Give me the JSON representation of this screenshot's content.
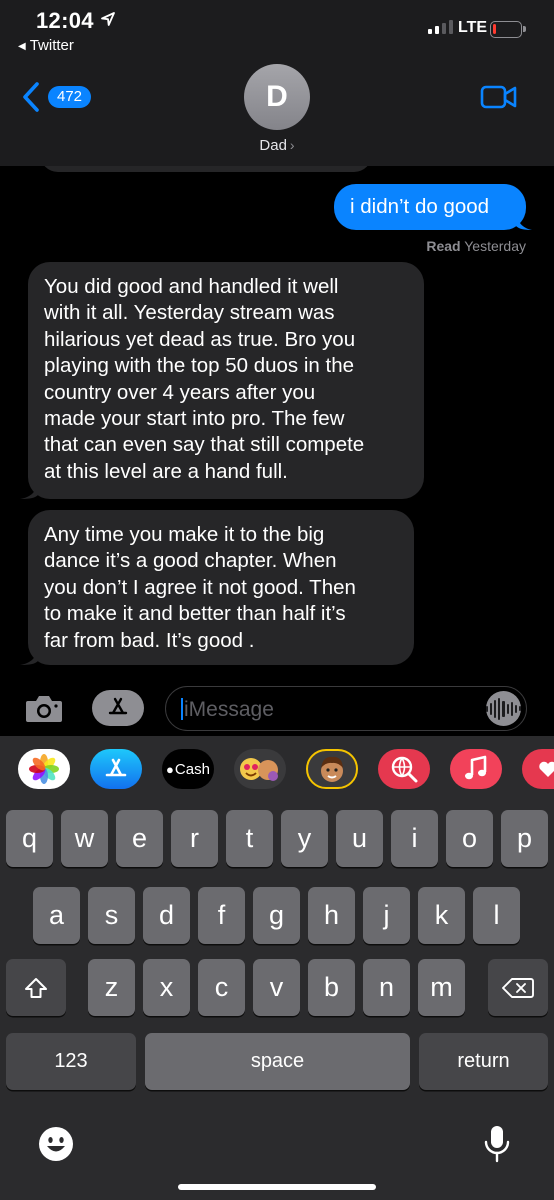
{
  "status_bar": {
    "time": "12:04",
    "back_app": "Twitter",
    "network": "LTE",
    "battery_level": 0.1,
    "battery_color": "#ff3b30"
  },
  "nav": {
    "back_count": "472",
    "avatar_initial": "D",
    "contact_name": "Dad",
    "video_icon": "video-camera-icon",
    "accent": "#0a84ff"
  },
  "messages": {
    "outgoing": [
      {
        "text": "i didn’t do good",
        "status_label": "Read",
        "status_time": "Yesterday"
      }
    ],
    "incoming": [
      {
        "lines": [
          "You did good and handled it well",
          "with it all. Yesterday stream was",
          "hilarious yet dead as true. Bro you",
          "playing with the top 50 duos in the",
          "country over 4 years after you",
          "made your start into pro. The few",
          "that can even say that still compete",
          "at this level are a hand full."
        ]
      },
      {
        "lines": [
          "Any time you make it to the big",
          "dance it’s a good chapter. When",
          "you don’t I agree it not good. Then",
          "to make it and better than half it’s",
          "far from bad. It’s good ."
        ]
      }
    ]
  },
  "composer": {
    "placeholder": "iMessage",
    "camera_icon": "camera-icon",
    "apps_icon": "app-store-icon",
    "audio_icon": "waveform-icon"
  },
  "app_strip": {
    "apps": [
      "photos",
      "app-store",
      "apple-cash",
      "memoji-stickers",
      "memoji",
      "web-images",
      "music",
      "more"
    ],
    "cash_label": "Cash"
  },
  "keyboard": {
    "row1": [
      "q",
      "w",
      "e",
      "r",
      "t",
      "y",
      "u",
      "i",
      "o",
      "p"
    ],
    "row2": [
      "a",
      "s",
      "d",
      "f",
      "g",
      "h",
      "j",
      "k",
      "l"
    ],
    "row3": [
      "z",
      "x",
      "c",
      "v",
      "b",
      "n",
      "m"
    ],
    "numbers_label": "123",
    "space_label": "space",
    "return_label": "return"
  }
}
